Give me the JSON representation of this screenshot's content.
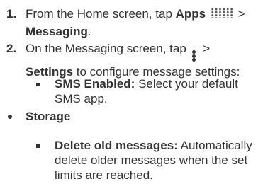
{
  "steps": [
    {
      "number": "1.",
      "line1_prefix": "From the Home screen, tap ",
      "line1_bold": "Apps",
      "line1_suffix": " >",
      "line2_bold": "Messaging",
      "line2_suffix": ".",
      "icon": "apps-grid-icon"
    },
    {
      "number": "2.",
      "line1_prefix": "On the Messaging screen, tap ",
      "line1_suffix": " >",
      "line2_bold": "Settings",
      "line2_suffix": " to configure message settings:",
      "icon": "menu-dots-icon"
    }
  ],
  "sms": {
    "label": "SMS Enabled:",
    "line1_text": " Select your default",
    "line2_text": "SMS app."
  },
  "storage": {
    "heading": "Storage",
    "delete": {
      "label": "Delete old messages:",
      "line1_text": " Automatically",
      "line2_text": "delete older messages when the set",
      "line3_text": "limits are reached."
    }
  }
}
